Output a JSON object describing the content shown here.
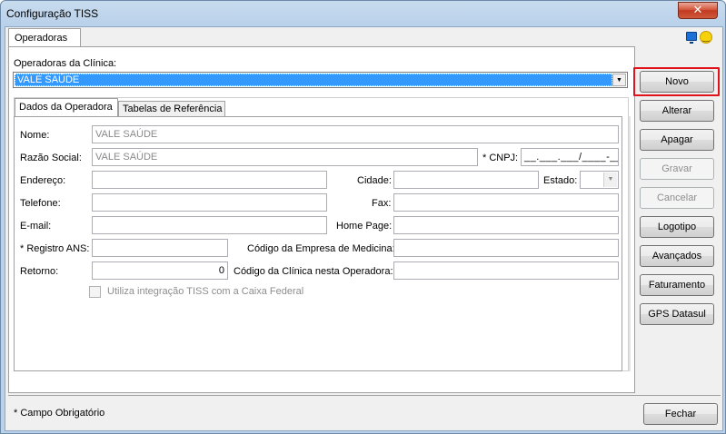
{
  "window": {
    "title": "Configuração TISS",
    "close_label": "✕"
  },
  "top_tabs": [
    {
      "label": "Operadoras"
    }
  ],
  "icons": {
    "monitor": "monitor-icon",
    "smile": "smile-icon"
  },
  "operadoras": {
    "label": "Operadoras da Clínica:",
    "selected": "VALE SAÚDE"
  },
  "inner_tabs": [
    {
      "label": "Dados da Operadora"
    },
    {
      "label": "Tabelas de Referência"
    }
  ],
  "form": {
    "nome": {
      "label": "Nome:",
      "value": "VALE SAÚDE"
    },
    "razao_social": {
      "label": "Razão Social:",
      "value": "VALE SAÚDE"
    },
    "cnpj": {
      "label": "* CNPJ:",
      "value": "__.___.___/____-__"
    },
    "endereco": {
      "label": "Endereço:",
      "value": ""
    },
    "cidade": {
      "label": "Cidade:",
      "value": ""
    },
    "estado": {
      "label": "Estado:",
      "value": ""
    },
    "telefone": {
      "label": "Telefone:",
      "value": ""
    },
    "fax": {
      "label": "Fax:",
      "value": ""
    },
    "email": {
      "label": "E-mail:",
      "value": ""
    },
    "homepage": {
      "label": "Home Page:",
      "value": ""
    },
    "registro_ans": {
      "label": "* Registro ANS:",
      "value": ""
    },
    "codigo_empresa": {
      "label": "Código da Empresa de Medicina:",
      "value": ""
    },
    "retorno": {
      "label": "Retorno:",
      "value": "0"
    },
    "codigo_clinica": {
      "label": "Código da Clínica nesta Operadora:",
      "value": ""
    },
    "integracao": {
      "label": "Utiliza integração TISS com a Caixa Federal",
      "checked": false
    }
  },
  "buttons": {
    "novo": "Novo",
    "alterar": "Alterar",
    "apagar": "Apagar",
    "gravar": "Gravar",
    "cancelar": "Cancelar",
    "logotipo": "Logotipo",
    "avancados": "Avançados",
    "faturamento": "Faturamento",
    "gps": "GPS Datasul",
    "fechar": "Fechar"
  },
  "footer": {
    "note": "* Campo Obrigatório"
  },
  "colors": {
    "highlight": "#e0131a",
    "selection": "#3399ff"
  }
}
